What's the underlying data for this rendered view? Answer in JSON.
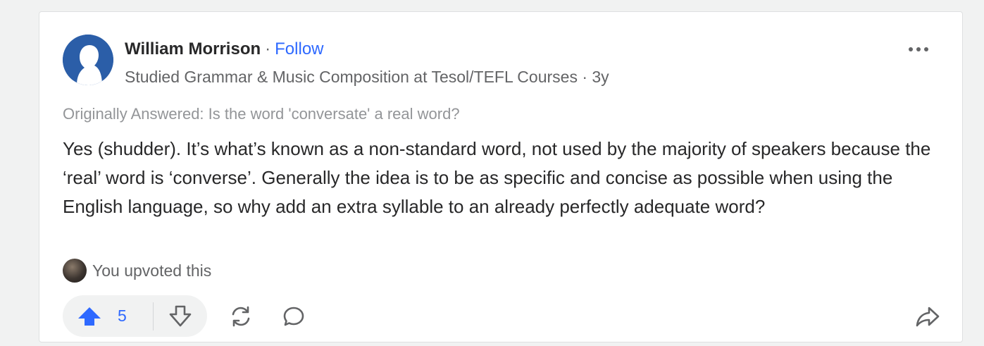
{
  "author": {
    "name": "William Morrison",
    "separator": "·",
    "follow_label": "Follow",
    "credential": "Studied Grammar & Music Composition at Tesol/TEFL Courses · 3y"
  },
  "original_question": "Originally Answered: Is the word 'conversate' a real word?",
  "answer_text": "Yes (shudder). It’s what’s known as a non-standard word, not used by the majority of speakers because the ‘real’ word is ‘converse’. Generally the idea is to be as specific and concise as possible when using the English language, so why add an extra syllable to an already perfectly adequate word?",
  "upvote_notice": "You upvoted this",
  "actions": {
    "upvote_count": "5"
  },
  "icons": {
    "more": "more-options-icon",
    "upvote": "upvote-arrow-icon",
    "downvote": "downvote-arrow-icon",
    "share": "share-cycle-icon",
    "comment": "comment-bubble-icon",
    "forward": "forward-share-icon"
  },
  "colors": {
    "accent": "#2e69ff",
    "avatar_bg": "#2b5ea8",
    "text": "#282829",
    "muted": "#636466",
    "faint": "#939598"
  }
}
